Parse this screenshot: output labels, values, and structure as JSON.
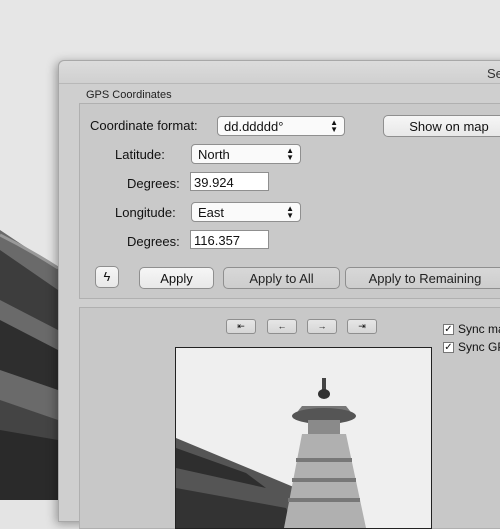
{
  "window": {
    "title": "Se"
  },
  "group": {
    "title": "GPS Coordinates"
  },
  "coordinate_format": {
    "label": "Coordinate format:",
    "value": "dd.ddddd°"
  },
  "show_on_map": {
    "label": "Show on map"
  },
  "latitude": {
    "label": "Latitude:",
    "value": "North",
    "degrees_label": "Degrees:",
    "degrees_value": "39.924"
  },
  "longitude": {
    "label": "Longitude:",
    "value": "East",
    "degrees_label": "Degrees:",
    "degrees_value": "116.357"
  },
  "buttons": {
    "lightning_icon": "lightning-icon",
    "apply": "Apply",
    "apply_all": "Apply to All",
    "apply_remaining": "Apply to Remaining"
  },
  "nav": {
    "first": "⇤",
    "prev": "←",
    "next": "→",
    "last": "⇥"
  },
  "sync": [
    {
      "label": "Sync ma",
      "checked": true
    },
    {
      "label": "Sync GP",
      "checked": true
    }
  ]
}
